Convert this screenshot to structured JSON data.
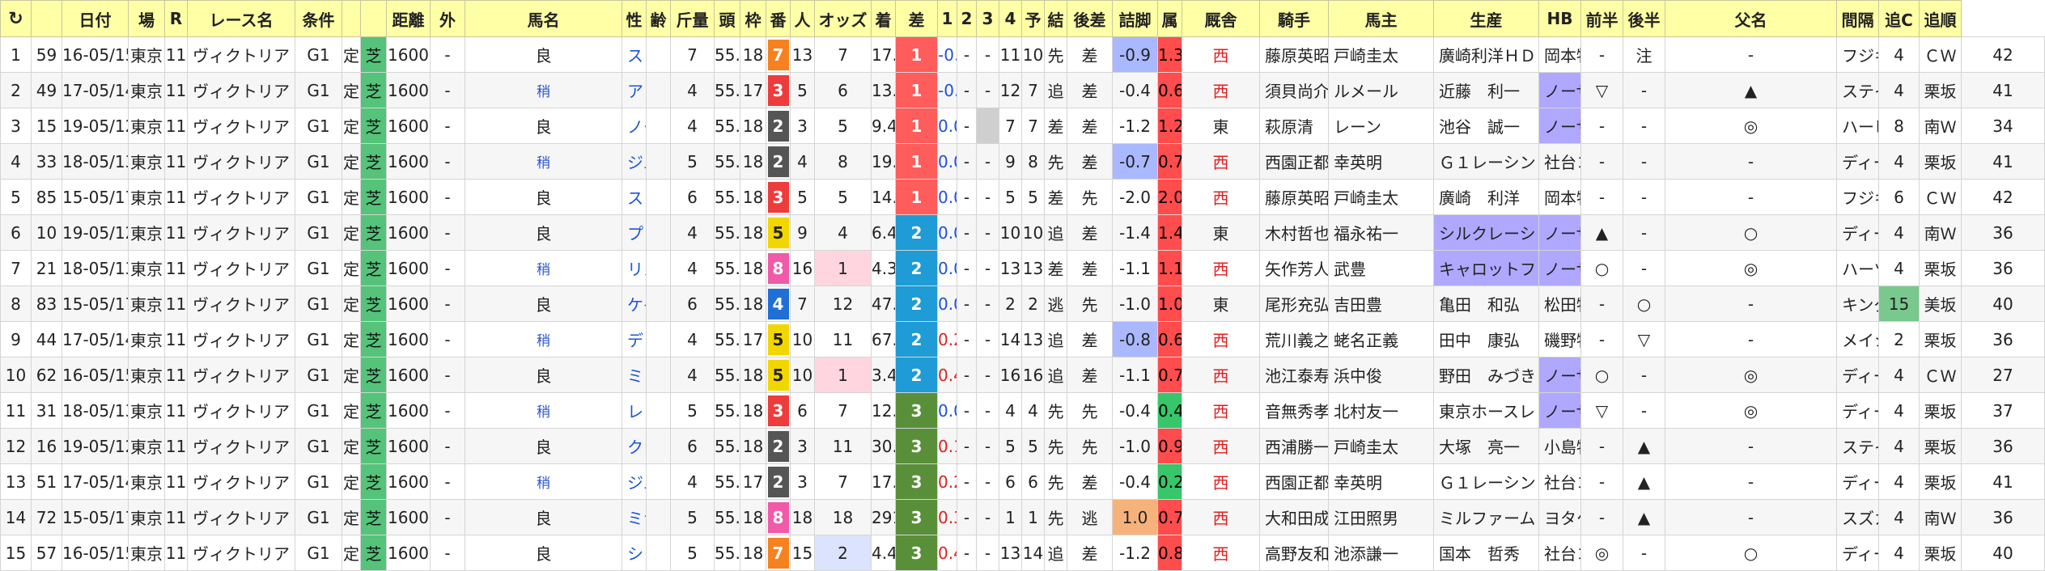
{
  "headers": [
    "C",
    "",
    "日付",
    "場",
    "R",
    "レース名",
    "条件",
    "",
    "",
    "距離",
    "外",
    "馬名",
    "性",
    "齢",
    "斤量",
    "頭",
    "枠",
    "番",
    "人",
    "オッズ",
    "着",
    "差",
    "1",
    "2",
    "3",
    "4",
    "予",
    "結",
    "後差",
    "詰脚",
    "属",
    "厩舎",
    "騎手",
    "馬主",
    "生産",
    "HB",
    "前半",
    "後半",
    "父名",
    "間隔",
    "追C",
    "追順"
  ],
  "reload_icon": "↻",
  "rows": [
    {
      "no": "1",
      "id": "59",
      "date": "16-05/15",
      "place": "東京",
      "r": "11",
      "race": "ヴィクトリア",
      "grade": "G1",
      "cond": "定",
      "surf": "芝",
      "dist": "1600",
      "out": "-",
      "kai": "",
      "going": "良",
      "horse": "ストレイトガール",
      "sex": "",
      "age": "7",
      "weight": "55.0",
      "heads": "18",
      "waku": "7",
      "wcol": "#f5821f",
      "num": "13",
      "pop": "7",
      "popcls": "",
      "odds": "17.7",
      "rank": "1",
      "diff": "-0.4",
      "c1": "-",
      "c2": "-",
      "c3": "11",
      "c4": "10",
      "yo": "先",
      "ke": "差",
      "go": "-0.9",
      "gocls": "post-blue",
      "tsu": "1.3",
      "tsucls": "tsume",
      "zoku": "西",
      "stable": "藤原英昭",
      "jockey": "戸崎圭太",
      "owner": "廣崎利洋ＨＤ",
      "ownercls": "",
      "breed": "岡本牧場",
      "breedcls": "",
      "hb": "-",
      "zen": "注",
      "kou": "-",
      "sire": "フジキセキ",
      "kan": "4",
      "kancls": "",
      "oic": "ＣＷ",
      "oij": "42"
    },
    {
      "no": "2",
      "id": "49",
      "date": "17-05/14",
      "place": "東京",
      "r": "11",
      "race": "ヴィクトリア",
      "grade": "G1",
      "cond": "定",
      "surf": "芝",
      "dist": "1600",
      "out": "-",
      "kai": "稍",
      "going": "",
      "horse": "アドマイヤリード",
      "sex": "",
      "age": "4",
      "weight": "55.0",
      "heads": "17",
      "waku": "3",
      "wcol": "#ee3b3b",
      "num": "5",
      "pop": "6",
      "popcls": "",
      "odds": "13.5",
      "rank": "1",
      "diff": "-0.2",
      "c1": "-",
      "c2": "-",
      "c3": "12",
      "c4": "7",
      "yo": "追",
      "ke": "差",
      "go": "-0.4",
      "gocls": "",
      "tsu": "0.6",
      "tsucls": "tsume",
      "zoku": "西",
      "stable": "須貝尚介",
      "jockey": "ルメール",
      "owner": "近藤　利一",
      "ownercls": "",
      "breed": "ノーザンファ",
      "breedcls": "breed-hl",
      "hb": "▽",
      "zen": "-",
      "kou": "▲",
      "sire": "ステイゴールド",
      "kan": "4",
      "kancls": "",
      "oic": "栗坂",
      "oij": "41"
    },
    {
      "no": "3",
      "id": "15",
      "date": "19-05/12",
      "place": "東京",
      "r": "11",
      "race": "ヴィクトリア",
      "grade": "G1",
      "cond": "定",
      "surf": "芝",
      "dist": "1600",
      "out": "-",
      "kai": "",
      "going": "良",
      "horse": "ノームコア",
      "sex": "",
      "age": "4",
      "weight": "55.0",
      "heads": "18",
      "waku": "2",
      "wcol": "#555555",
      "num": "3",
      "pop": "5",
      "popcls": "",
      "odds": "9.4",
      "rank": "1",
      "diff": "0.0",
      "c1": "-",
      "c2": "gray",
      "c3": "7",
      "c4": "7",
      "yo": "差",
      "ke": "差",
      "go": "-1.2",
      "gocls": "",
      "tsu": "1.2",
      "tsucls": "tsume",
      "zoku": "東",
      "stable": "萩原清",
      "jockey": "レーン",
      "owner": "池谷　誠一",
      "ownercls": "",
      "breed": "ノーザンファ",
      "breedcls": "breed-hl",
      "hb": "-",
      "zen": "-",
      "kou": "◎",
      "sire": "ハービンジャー",
      "kan": "8",
      "kancls": "",
      "oic": "南Ｗ",
      "oij": "34"
    },
    {
      "no": "4",
      "id": "33",
      "date": "18-05/13",
      "place": "東京",
      "r": "11",
      "race": "ヴィクトリア",
      "grade": "G1",
      "cond": "定",
      "surf": "芝",
      "dist": "1600",
      "out": "-",
      "kai": "稍",
      "going": "",
      "horse": "ジュールポレール",
      "sex": "",
      "age": "5",
      "weight": "55.0",
      "heads": "18",
      "waku": "2",
      "wcol": "#555555",
      "num": "4",
      "pop": "8",
      "popcls": "",
      "odds": "19.4",
      "rank": "1",
      "diff": "0.0",
      "c1": "-",
      "c2": "-",
      "c3": "9",
      "c4": "8",
      "yo": "先",
      "ke": "差",
      "go": "-0.7",
      "gocls": "post-blue",
      "tsu": "0.7",
      "tsucls": "tsume",
      "zoku": "西",
      "stable": "西園正都",
      "jockey": "幸英明",
      "owner": "Ｇ１レーシン",
      "ownercls": "",
      "breed": "社台コーポレ",
      "breedcls": "",
      "hb": "-",
      "zen": "-",
      "kou": "-",
      "sire": "ディープインパクト",
      "kan": "4",
      "kancls": "",
      "oic": "栗坂",
      "oij": "41"
    },
    {
      "no": "5",
      "id": "85",
      "date": "15-05/17",
      "place": "東京",
      "r": "11",
      "race": "ヴィクトリア",
      "grade": "G1",
      "cond": "定",
      "surf": "芝",
      "dist": "1600",
      "out": "-",
      "kai": "",
      "going": "良",
      "horse": "ストレイトガール",
      "sex": "",
      "age": "6",
      "weight": "55.0",
      "heads": "18",
      "waku": "3",
      "wcol": "#ee3b3b",
      "num": "5",
      "pop": "5",
      "popcls": "",
      "odds": "14.1",
      "rank": "1",
      "diff": "0.0",
      "c1": "-",
      "c2": "-",
      "c3": "5",
      "c4": "5",
      "yo": "差",
      "ke": "先",
      "go": "-2.0",
      "gocls": "",
      "tsu": "2.0",
      "tsucls": "tsume",
      "zoku": "西",
      "stable": "藤原英昭",
      "jockey": "戸崎圭太",
      "owner": "廣崎　利洋",
      "ownercls": "",
      "breed": "岡本牧場",
      "breedcls": "",
      "hb": "-",
      "zen": "-",
      "kou": "-",
      "sire": "フジキセキ",
      "kan": "6",
      "kancls": "",
      "oic": "ＣＷ",
      "oij": "42"
    },
    {
      "no": "6",
      "id": "10",
      "date": "19-05/12",
      "place": "東京",
      "r": "11",
      "race": "ヴィクトリア",
      "grade": "G1",
      "cond": "定",
      "surf": "芝",
      "dist": "1600",
      "out": "-",
      "kai": "",
      "going": "良",
      "horse": "プリモシーン",
      "sex": "",
      "age": "4",
      "weight": "55.0",
      "heads": "18",
      "waku": "5",
      "wcol": "#f2d600",
      "num": "9",
      "pop": "4",
      "popcls": "",
      "odds": "6.4",
      "rank": "2",
      "diff": "0.0",
      "c1": "-",
      "c2": "-",
      "c3": "10",
      "c4": "10",
      "yo": "追",
      "ke": "差",
      "go": "-1.4",
      "gocls": "",
      "tsu": "1.4",
      "tsucls": "tsume",
      "zoku": "東",
      "stable": "木村哲也",
      "jockey": "福永祐一",
      "owner": "シルクレーシ",
      "ownercls": "owner-hl",
      "breed": "ノーザンファ",
      "breedcls": "breed-hl",
      "hb": "▲",
      "zen": "-",
      "kou": "○",
      "sire": "ディープインパクト",
      "kan": "4",
      "kancls": "",
      "oic": "南Ｗ",
      "oij": "36"
    },
    {
      "no": "7",
      "id": "21",
      "date": "18-05/13",
      "place": "東京",
      "r": "11",
      "race": "ヴィクトリア",
      "grade": "G1",
      "cond": "定",
      "surf": "芝",
      "dist": "1600",
      "out": "-",
      "kai": "稍",
      "going": "",
      "horse": "リスグラシュー",
      "sex": "",
      "age": "4",
      "weight": "55.0",
      "heads": "18",
      "waku": "8",
      "wcol": "#f05aa8",
      "num": "16",
      "pop": "1",
      "popcls": "hl",
      "odds": "4.3",
      "rank": "2",
      "diff": "0.0",
      "c1": "-",
      "c2": "-",
      "c3": "13",
      "c4": "13",
      "yo": "差",
      "ke": "差",
      "go": "-1.1",
      "gocls": "",
      "tsu": "1.1",
      "tsucls": "tsume",
      "zoku": "西",
      "stable": "矢作芳人",
      "jockey": "武豊",
      "owner": "キャロットフ",
      "ownercls": "owner-hl",
      "breed": "ノーザンファ",
      "breedcls": "breed-hl",
      "hb": "○",
      "zen": "-",
      "kou": "◎",
      "sire": "ハーツクライ",
      "kan": "4",
      "kancls": "",
      "oic": "栗坂",
      "oij": "36"
    },
    {
      "no": "8",
      "id": "83",
      "date": "15-05/17",
      "place": "東京",
      "r": "11",
      "race": "ヴィクトリア",
      "grade": "G1",
      "cond": "定",
      "surf": "芝",
      "dist": "1600",
      "out": "-",
      "kai": "",
      "going": "良",
      "horse": "ケイアイエレガント",
      "sex": "",
      "age": "6",
      "weight": "55.0",
      "heads": "18",
      "waku": "4",
      "wcol": "#1f6fd6",
      "num": "7",
      "pop": "12",
      "popcls": "",
      "odds": "47.4",
      "rank": "2",
      "diff": "0.0",
      "c1": "-",
      "c2": "-",
      "c3": "2",
      "c4": "2",
      "yo": "逃",
      "ke": "先",
      "go": "-1.0",
      "gocls": "",
      "tsu": "1.0",
      "tsucls": "tsume",
      "zoku": "東",
      "stable": "尾形充弘",
      "jockey": "吉田豊",
      "owner": "亀田　和弘",
      "ownercls": "",
      "breed": "松田牧場",
      "breedcls": "",
      "hb": "-",
      "zen": "○",
      "kou": "-",
      "sire": "キングカメハメハ",
      "kan": "15",
      "kancls": "kankaku-hl",
      "oic": "美坂",
      "oij": "40"
    },
    {
      "no": "9",
      "id": "44",
      "date": "17-05/14",
      "place": "東京",
      "r": "11",
      "race": "ヴィクトリア",
      "grade": "G1",
      "cond": "定",
      "surf": "芝",
      "dist": "1600",
      "out": "-",
      "kai": "稍",
      "going": "",
      "horse": "デンコウアンジュ",
      "sex": "",
      "age": "4",
      "weight": "55.0",
      "heads": "17",
      "waku": "5",
      "wcol": "#f2d600",
      "num": "10",
      "pop": "11",
      "popcls": "",
      "odds": "67.9",
      "rank": "2",
      "diff": "0.2",
      "c1": "-",
      "c2": "-",
      "c3": "14",
      "c4": "13",
      "yo": "追",
      "ke": "差",
      "go": "-0.8",
      "gocls": "post-blue",
      "tsu": "0.6",
      "tsucls": "tsume",
      "zoku": "西",
      "stable": "荒川義之",
      "jockey": "蛯名正義",
      "owner": "田中　康弘",
      "ownercls": "",
      "breed": "磯野牧場",
      "breedcls": "",
      "hb": "-",
      "zen": "▽",
      "kou": "-",
      "sire": "メイショウサムソン",
      "kan": "2",
      "kancls": "",
      "oic": "栗坂",
      "oij": "36"
    },
    {
      "no": "10",
      "id": "62",
      "date": "16-05/15",
      "place": "東京",
      "r": "11",
      "race": "ヴィクトリア",
      "grade": "G1",
      "cond": "定",
      "surf": "芝",
      "dist": "1600",
      "out": "-",
      "kai": "",
      "going": "良",
      "horse": "ミッキークイーン",
      "sex": "",
      "age": "4",
      "weight": "55.0",
      "heads": "18",
      "waku": "5",
      "wcol": "#f2d600",
      "num": "10",
      "pop": "1",
      "popcls": "hl",
      "odds": "3.4",
      "rank": "2",
      "diff": "0.4",
      "c1": "-",
      "c2": "-",
      "c3": "16",
      "c4": "16",
      "yo": "追",
      "ke": "差",
      "go": "-1.1",
      "gocls": "",
      "tsu": "0.7",
      "tsucls": "tsume",
      "zoku": "西",
      "stable": "池江泰寿",
      "jockey": "浜中俊",
      "owner": "野田　みづき",
      "ownercls": "",
      "breed": "ノーザンファ",
      "breedcls": "breed-hl",
      "hb": "○",
      "zen": "-",
      "kou": "◎",
      "sire": "ディープインパクト",
      "kan": "4",
      "kancls": "",
      "oic": "ＣＷ",
      "oij": "27"
    },
    {
      "no": "11",
      "id": "31",
      "date": "18-05/13",
      "place": "東京",
      "r": "11",
      "race": "ヴィクトリア",
      "grade": "G1",
      "cond": "定",
      "surf": "芝",
      "dist": "1600",
      "out": "-",
      "kai": "稍",
      "going": "",
      "horse": "レッドアヴァンセ",
      "sex": "",
      "age": "5",
      "weight": "55.0",
      "heads": "18",
      "waku": "3",
      "wcol": "#ee3b3b",
      "num": "6",
      "pop": "7",
      "popcls": "",
      "odds": "12.1",
      "rank": "3",
      "diff": "0.0",
      "c1": "-",
      "c2": "-",
      "c3": "4",
      "c4": "4",
      "yo": "先",
      "ke": "先",
      "go": "-0.4",
      "gocls": "",
      "tsu": "0.4",
      "tsucls": "tsume-green",
      "zoku": "西",
      "stable": "音無秀孝",
      "jockey": "北村友一",
      "owner": "東京ホースレ",
      "ownercls": "",
      "breed": "ノーザンファ",
      "breedcls": "breed-hl",
      "hb": "▽",
      "zen": "-",
      "kou": "◎",
      "sire": "ディープインパクト",
      "kan": "4",
      "kancls": "",
      "oic": "栗坂",
      "oij": "37"
    },
    {
      "no": "12",
      "id": "16",
      "date": "19-05/12",
      "place": "東京",
      "r": "11",
      "race": "ヴィクトリア",
      "grade": "G1",
      "cond": "定",
      "surf": "芝",
      "dist": "1600",
      "out": "-",
      "kai": "",
      "going": "良",
      "horse": "クロコスミア",
      "sex": "",
      "age": "6",
      "weight": "55.0",
      "heads": "18",
      "waku": "2",
      "wcol": "#555555",
      "num": "3",
      "pop": "11",
      "popcls": "",
      "odds": "30.8",
      "rank": "3",
      "diff": "0.1",
      "c1": "-",
      "c2": "-",
      "c3": "5",
      "c4": "5",
      "yo": "先",
      "ke": "先",
      "go": "-1.0",
      "gocls": "",
      "tsu": "0.9",
      "tsucls": "tsume",
      "zoku": "西",
      "stable": "西浦勝一",
      "jockey": "戸崎圭太",
      "owner": "大塚　亮一",
      "ownercls": "",
      "breed": "小島牧場",
      "breedcls": "",
      "hb": "-",
      "zen": "▲",
      "kou": "-",
      "sire": "ステイゴールド",
      "kan": "4",
      "kancls": "",
      "oic": "栗坂",
      "oij": "36"
    },
    {
      "no": "13",
      "id": "51",
      "date": "17-05/14",
      "place": "東京",
      "r": "11",
      "race": "ヴィクトリア",
      "grade": "G1",
      "cond": "定",
      "surf": "芝",
      "dist": "1600",
      "out": "-",
      "kai": "稍",
      "going": "",
      "horse": "ジュールポレール",
      "sex": "",
      "age": "4",
      "weight": "55.0",
      "heads": "17",
      "waku": "2",
      "wcol": "#555555",
      "num": "3",
      "pop": "7",
      "popcls": "",
      "odds": "17.5",
      "rank": "3",
      "diff": "0.2",
      "c1": "-",
      "c2": "-",
      "c3": "6",
      "c4": "6",
      "yo": "先",
      "ke": "差",
      "go": "-0.4",
      "gocls": "",
      "tsu": "0.2",
      "tsucls": "tsume-green",
      "zoku": "西",
      "stable": "西園正都",
      "jockey": "幸英明",
      "owner": "Ｇ１レーシン",
      "ownercls": "",
      "breed": "社台コーポレ",
      "breedcls": "",
      "hb": "-",
      "zen": "▲",
      "kou": "-",
      "sire": "ディープインパクト",
      "kan": "4",
      "kancls": "",
      "oic": "栗坂",
      "oij": "41"
    },
    {
      "no": "14",
      "id": "72",
      "date": "15-05/17",
      "place": "東京",
      "r": "11",
      "race": "ヴィクトリア",
      "grade": "G1",
      "cond": "定",
      "surf": "芝",
      "dist": "1600",
      "out": "-",
      "kai": "",
      "going": "良",
      "horse": "ミナレット",
      "sex": "",
      "age": "5",
      "weight": "55.0",
      "heads": "18",
      "waku": "8",
      "wcol": "#f05aa8",
      "num": "18",
      "pop": "18",
      "popcls": "",
      "odds": "291.8",
      "rank": "3",
      "diff": "0.3",
      "c1": "-",
      "c2": "-",
      "c3": "1",
      "c4": "1",
      "yo": "先",
      "ke": "逃",
      "go": "1.0",
      "gocls": "post-orange",
      "tsu": "0.7",
      "tsucls": "tsume",
      "zoku": "西",
      "stable": "大和田成",
      "jockey": "江田照男",
      "owner": "ミルファーム",
      "ownercls": "",
      "breed": "ヨタケ牧場",
      "breedcls": "",
      "hb": "-",
      "zen": "▲",
      "kou": "-",
      "sire": "スズカマンボ",
      "kan": "4",
      "kancls": "",
      "oic": "南Ｗ",
      "oij": "36"
    },
    {
      "no": "15",
      "id": "57",
      "date": "16-05/15",
      "place": "東京",
      "r": "11",
      "race": "ヴィクトリア",
      "grade": "G1",
      "cond": "定",
      "surf": "芝",
      "dist": "1600",
      "out": "-",
      "kai": "",
      "going": "良",
      "horse": "ショウナンパンドラ",
      "sex": "",
      "age": "5",
      "weight": "55.0",
      "heads": "18",
      "waku": "7",
      "wcol": "#f5821f",
      "num": "15",
      "pop": "2",
      "popcls": "hl2",
      "odds": "4.4",
      "rank": "3",
      "diff": "0.4",
      "c1": "-",
      "c2": "-",
      "c3": "13",
      "c4": "14",
      "yo": "追",
      "ke": "差",
      "go": "-1.2",
      "gocls": "",
      "tsu": "0.8",
      "tsucls": "tsume",
      "zoku": "西",
      "stable": "高野友和",
      "jockey": "池添謙一",
      "owner": "国本　哲秀",
      "ownercls": "",
      "breed": "社台コーポレ",
      "breedcls": "",
      "hb": "◎",
      "zen": "-",
      "kou": "○",
      "sire": "ディープインパクト",
      "kan": "4",
      "kancls": "",
      "oic": "栗坂",
      "oij": "40"
    }
  ]
}
